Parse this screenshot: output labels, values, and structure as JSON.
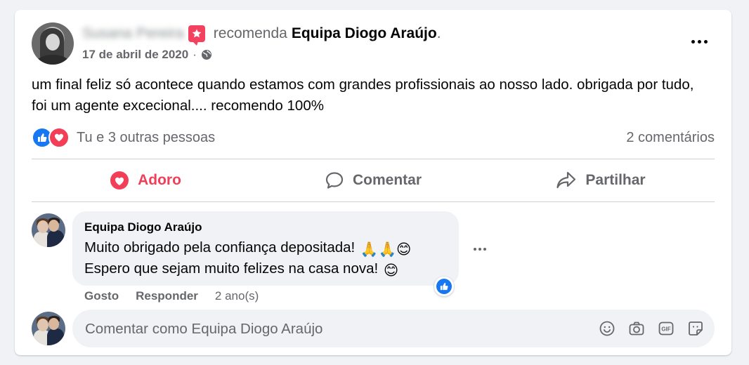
{
  "post": {
    "author_name": "Susana Pereira",
    "action_verb": "recomenda",
    "page_name": "Equipa Diogo Araújo",
    "page_suffix": ".",
    "date": "17 de abril de 2020",
    "date_separator": "·",
    "text": "um final feliz só acontece quando estamos com grandes profissionais ao nosso lado. obrigada por tudo, foi um agente excecional.... recomendo 100%",
    "reactions_label": "Tu e 3 outras pessoas",
    "reaction_icons": [
      "like-icon",
      "love-icon"
    ],
    "comments_count": "2 comentários"
  },
  "actions": {
    "love_label": "Adoro",
    "comment_label": "Comentar",
    "share_label": "Partilhar"
  },
  "comment": {
    "author": "Equipa Diogo Araújo",
    "line1": "Muito obrigado pela confiança depositada!",
    "line1_emoji": "🙏🙏😊",
    "line2": "Espero que sejam muito felizes na casa nova!",
    "line2_emoji": "😊",
    "like_label": "Gosto",
    "reply_label": "Responder",
    "time": "2 ano(s)"
  },
  "composer": {
    "placeholder": "Comentar como Equipa Diogo Araújo",
    "icons": [
      "emoji-icon",
      "camera-icon",
      "gif-icon",
      "sticker-icon"
    ]
  },
  "colors": {
    "accent_blue": "#1877f2",
    "love_red": "#f33e58",
    "recommend_badge": "#f3425f",
    "muted_text": "#65676b"
  }
}
